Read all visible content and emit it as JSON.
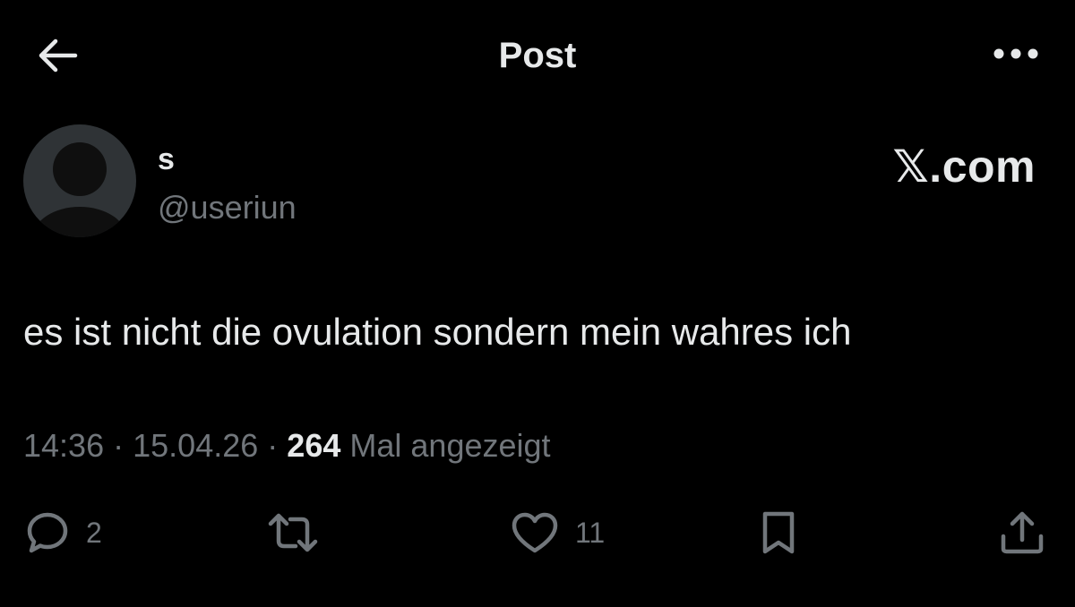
{
  "header": {
    "title": "Post",
    "back_icon": "arrow-left-icon",
    "more_icon": "more-horizontal-icon"
  },
  "author": {
    "display_name": "s",
    "handle": "@useriun",
    "avatar_icon": "default-avatar-icon"
  },
  "watermark": "𝕏.com",
  "post": {
    "text": "es ist nicht die ovulation sondern mein wahres ich",
    "time": "14:36",
    "date": "15.04.26",
    "separator": "·",
    "views_count": "264",
    "views_label": "Mal angezeigt"
  },
  "actions": {
    "reply": {
      "icon": "reply-icon",
      "count": "2"
    },
    "repost": {
      "icon": "repost-icon",
      "count": ""
    },
    "like": {
      "icon": "heart-icon",
      "count": "11"
    },
    "bookmark": {
      "icon": "bookmark-icon",
      "count": ""
    },
    "share": {
      "icon": "share-icon",
      "count": ""
    }
  },
  "colors": {
    "background": "#000000",
    "primary_text": "#e7e9ea",
    "secondary_text": "#71767b",
    "avatar_bg": "#2f3336"
  }
}
